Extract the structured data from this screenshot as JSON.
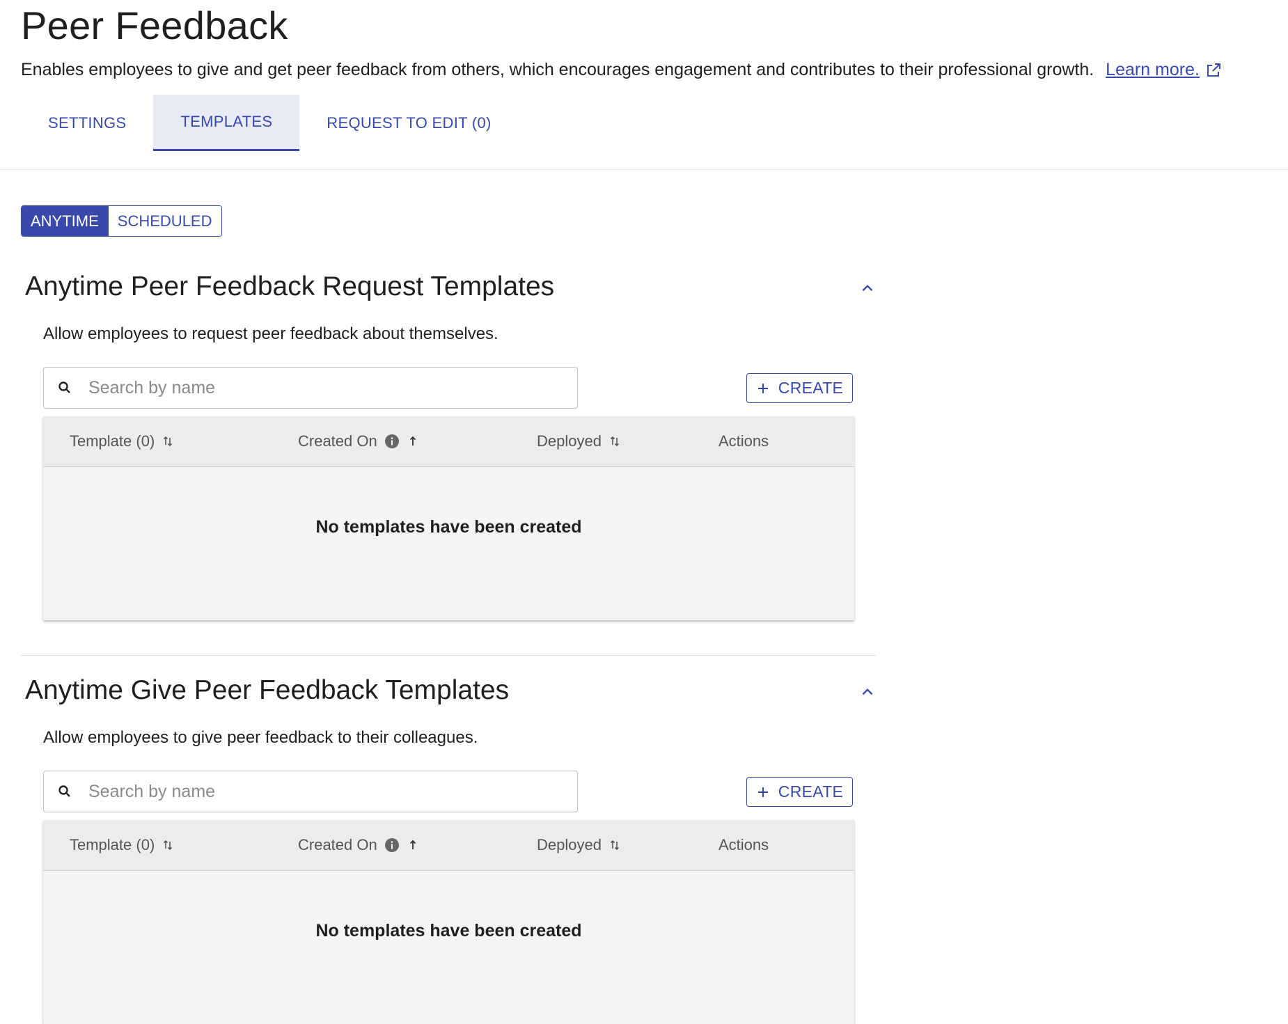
{
  "header": {
    "title": "Peer Feedback",
    "description": "Enables employees to give and get peer feedback from others, which encourages engagement and contributes to their professional growth.",
    "learn_more": "Learn more."
  },
  "tabs": [
    {
      "label": "SETTINGS",
      "active": false
    },
    {
      "label": "TEMPLATES",
      "active": true
    },
    {
      "label": "REQUEST TO EDIT (0)",
      "active": false
    }
  ],
  "segment": {
    "options": [
      "ANYTIME",
      "SCHEDULED"
    ],
    "selected": "ANYTIME"
  },
  "sections": [
    {
      "title": "Anytime Peer Feedback Request Templates",
      "description": "Allow employees to request peer feedback about themselves.",
      "search_placeholder": "Search by name",
      "create_label": "CREATE",
      "columns": [
        "Template (0)",
        "Created On",
        "Deployed",
        "Actions"
      ],
      "empty_message": "No templates have been created"
    },
    {
      "title": "Anytime Give Peer Feedback Templates",
      "description": "Allow employees to give peer feedback to their colleagues.",
      "search_placeholder": "Search by name",
      "create_label": "CREATE",
      "columns": [
        "Template (0)",
        "Created On",
        "Deployed",
        "Actions"
      ],
      "empty_message": "No templates have been created"
    }
  ],
  "icons": {
    "external_link": "external-link-icon",
    "collapse": "chevron-up-icon",
    "search": "search-icon",
    "add": "plus-icon",
    "sort": "sort-icon",
    "sort_ascending": "arrow-up-icon",
    "info": "info-icon"
  },
  "colors": {
    "accent": "#3949ab",
    "active_tab_bg": "#e8eaf6",
    "table_header_bg": "#ececec",
    "table_body_bg": "#f4f4f4"
  }
}
